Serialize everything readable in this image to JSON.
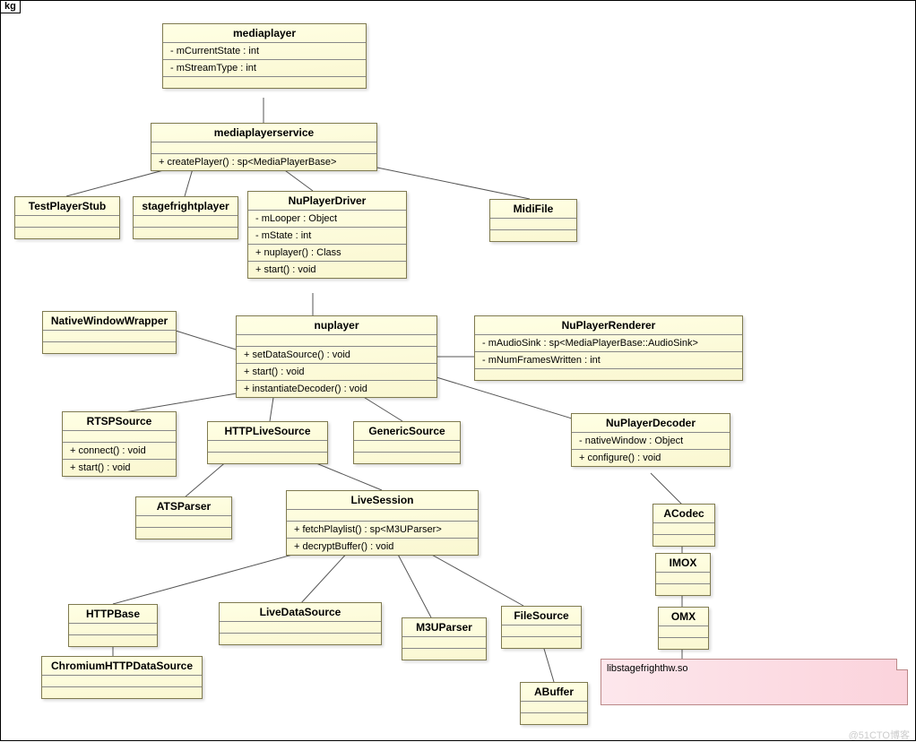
{
  "package_label": "kg",
  "watermark": "@51CTO博客",
  "note": "libstagefrighthw.so",
  "classes": {
    "mediaplayer": {
      "name": "mediaplayer",
      "attrs": [
        "- mCurrentState : int",
        "- mStreamType : int"
      ]
    },
    "mediaplayerservice": {
      "name": "mediaplayerservice",
      "ops": [
        "+ createPlayer() : sp<MediaPlayerBase>"
      ]
    },
    "TestPlayerStub": {
      "name": "TestPlayerStub"
    },
    "stagefrightplayer": {
      "name": "stagefrightplayer"
    },
    "NuPlayerDriver": {
      "name": "NuPlayerDriver",
      "attrs": [
        "- mLooper : Object",
        "- mState : int"
      ],
      "ops": [
        "+ nuplayer() : Class",
        "+ start() : void"
      ]
    },
    "MidiFile": {
      "name": "MidiFile"
    },
    "NativeWindowWrapper": {
      "name": "NativeWindowWrapper"
    },
    "nuplayer": {
      "name": "nuplayer",
      "ops": [
        "+ setDataSource() : void",
        "+ start() : void",
        "+ instantiateDecoder() : void"
      ]
    },
    "NuPlayerRenderer": {
      "name": "NuPlayerRenderer",
      "attrs": [
        "- mAudioSink : sp<MediaPlayerBase::AudioSink>",
        "- mNumFramesWritten : int"
      ]
    },
    "RTSPSource": {
      "name": "RTSPSource",
      "ops": [
        "+ connect() : void",
        "+ start() : void"
      ]
    },
    "HTTPLiveSource": {
      "name": "HTTPLiveSource"
    },
    "GenericSource": {
      "name": "GenericSource"
    },
    "NuPlayerDecoder": {
      "name": "NuPlayerDecoder",
      "attrs": [
        "- nativeWindow : Object"
      ],
      "ops": [
        "+ configure() : void"
      ]
    },
    "ATSParser": {
      "name": "ATSParser"
    },
    "LiveSession": {
      "name": "LiveSession",
      "ops": [
        "+ fetchPlaylist() : sp<M3UParser>",
        "+ decryptBuffer() : void"
      ]
    },
    "ACodec": {
      "name": "ACodec"
    },
    "IMOX": {
      "name": "IMOX"
    },
    "HTTPBase": {
      "name": "HTTPBase"
    },
    "LiveDataSource": {
      "name": "LiveDataSource"
    },
    "M3UParser": {
      "name": "M3UParser"
    },
    "FileSource": {
      "name": "FileSource"
    },
    "OMX": {
      "name": "OMX"
    },
    "ChromiumHTTPDataSource": {
      "name": "ChromiumHTTPDataSource"
    },
    "ABuffer": {
      "name": "ABuffer"
    }
  },
  "edges": [
    [
      "mediaplayer",
      "mediaplayerservice"
    ],
    [
      "mediaplayerservice",
      "TestPlayerStub"
    ],
    [
      "mediaplayerservice",
      "stagefrightplayer"
    ],
    [
      "mediaplayerservice",
      "NuPlayerDriver"
    ],
    [
      "mediaplayerservice",
      "MidiFile"
    ],
    [
      "NuPlayerDriver",
      "nuplayer"
    ],
    [
      "nuplayer",
      "NativeWindowWrapper"
    ],
    [
      "nuplayer",
      "NuPlayerRenderer"
    ],
    [
      "nuplayer",
      "RTSPSource"
    ],
    [
      "nuplayer",
      "HTTPLiveSource"
    ],
    [
      "nuplayer",
      "GenericSource"
    ],
    [
      "nuplayer",
      "NuPlayerDecoder"
    ],
    [
      "HTTPLiveSource",
      "ATSParser"
    ],
    [
      "HTTPLiveSource",
      "LiveSession"
    ],
    [
      "LiveSession",
      "HTTPBase"
    ],
    [
      "LiveSession",
      "LiveDataSource"
    ],
    [
      "LiveSession",
      "M3UParser"
    ],
    [
      "LiveSession",
      "FileSource"
    ],
    [
      "HTTPBase",
      "ChromiumHTTPDataSource"
    ],
    [
      "FileSource",
      "ABuffer"
    ],
    [
      "NuPlayerDecoder",
      "ACodec"
    ],
    [
      "ACodec",
      "IMOX"
    ],
    [
      "IMOX",
      "OMX"
    ],
    [
      "OMX",
      "note"
    ]
  ]
}
